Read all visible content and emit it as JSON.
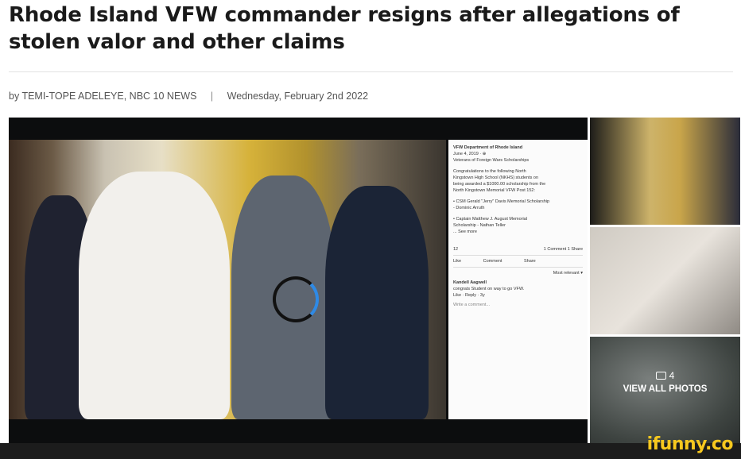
{
  "article": {
    "headline": "Rhode Island VFW commander resigns after allegations of stolen valor and other claims",
    "byline": "by TEMI-TOPE ADELEYE, NBC 10 NEWS",
    "separator": "|",
    "date": "Wednesday, February 2nd 2022"
  },
  "gallery": {
    "photo_count": "4",
    "view_all_label": "VIEW ALL PHOTOS"
  },
  "fb_post": {
    "org": "VFW Department of Rhode Island",
    "date": "June 4, 2019 · ⊕",
    "title": "Veterans of Foreign Wars Scholarships",
    "body1": "Congratulations to the following North",
    "body2": "Kingstown High School (NKHS) students on",
    "body3": "being awarded a $1000.00 scholarship from the",
    "body4": "North Kingstown Memorial VFW Post 152:",
    "item1": "• CSM Gerald \"Jerry\" Davis Memorial Scholarship",
    "item1b": "- Dominic Arruth",
    "item2": "• Captain Matthew J. August Memorial",
    "item2b": "Scholarship - Nathan Teller",
    "see_more": "... See more",
    "reactions": "12",
    "comments": "1 Comment 1 Share",
    "like": "Like",
    "comment": "Comment",
    "share": "Share",
    "most_relevant": "Most relevant ▾",
    "commenter": "Kandell Aagwell",
    "comment_text": "congrats Student on way to go VFW.",
    "comment_actions": "Like · Reply · 3y",
    "write_comment": "Write a comment..."
  },
  "branding": {
    "watermark": "ifunny.co"
  },
  "colors": {
    "watermark": "#f7c81e",
    "bottom_bar": "#1c1c1c"
  }
}
